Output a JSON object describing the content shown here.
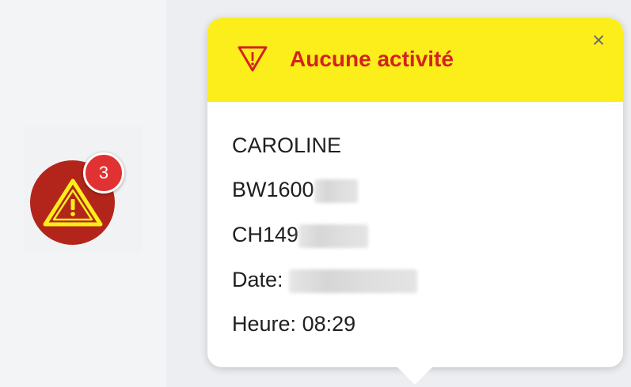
{
  "marker": {
    "icon": "warning-triangle-icon",
    "badge_count": "3",
    "color": "#b3251b",
    "badge_color": "#e03232"
  },
  "popup": {
    "header_icon": "warning-triangle-icon",
    "title": "Aucune activité",
    "close_label": "×",
    "header_color": "#fcee1a",
    "title_color": "#d32222",
    "lines": {
      "name": "CAROLINE",
      "code1_visible": "BW1600",
      "code2_visible": "CH149",
      "date_label": "Date:",
      "time_label": "Heure:",
      "time_value": "08:29"
    }
  }
}
